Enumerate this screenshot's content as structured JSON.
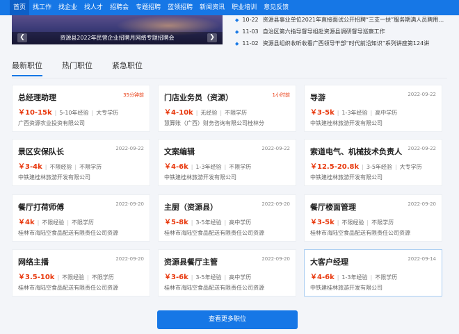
{
  "nav": {
    "items": [
      "首页",
      "找工作",
      "找企业",
      "找人才",
      "招聘会",
      "专题招聘",
      "蓝领招聘",
      "新闻资讯",
      "职业培训",
      "意见反馈"
    ]
  },
  "banner": {
    "caption": "资源县2022年民营企业招聘月网络专题招聘会"
  },
  "news": [
    {
      "date": "10-22",
      "title": "资源县事业单位2021年直接面试公开招聘“三支一扶”服务期满人员聘用…"
    },
    {
      "date": "11-03",
      "title": "自治区第六指导督导组赴资源县调研督导巡察工作"
    },
    {
      "date": "11-02",
      "title": "资源县组织收听收看广西领导干部“时代前沿知识”系列讲座第124讲"
    }
  ],
  "tabs": [
    "最新职位",
    "热门职位",
    "紧急职位"
  ],
  "jobs": [
    {
      "title": "总经理助理",
      "time": "35分钟前",
      "salary": "￥10-15k",
      "exp": "5-10年经验",
      "edu": "大专学历",
      "company": "广西资源农业投资有限公司"
    },
    {
      "title": "门店业务员（资源）",
      "time": "1小时前",
      "salary": "￥4-10k",
      "exp": "无经验",
      "edu": "不限学历",
      "company": "慧算账（广西）财务咨询有限公司桂林分"
    },
    {
      "title": "导游",
      "time": "2022-09-22",
      "salary": "￥3-5k",
      "exp": "1-3年经验",
      "edu": "高中学历",
      "company": "中铁建桂林旅游开发有限公司"
    },
    {
      "title": "景区安保队长",
      "time": "2022-09-22",
      "salary": "￥3-4k",
      "exp": "不限经验",
      "edu": "不限学历",
      "company": "中铁建桂林旅游开发有限公司"
    },
    {
      "title": "文案编辑",
      "time": "2022-09-22",
      "salary": "￥4-6k",
      "exp": "1-3年经验",
      "edu": "不限学历",
      "company": "中铁建桂林旅游开发有限公司"
    },
    {
      "title": "索道电气、机械技术负责人",
      "time": "2022-09-22",
      "salary": "￥12.5-20.8k",
      "exp": "3-5年经验",
      "edu": "大专学历",
      "company": "中铁建桂林旅游开发有限公司"
    },
    {
      "title": "餐厅打荷师傅",
      "time": "2022-09-20",
      "salary": "￥4k",
      "exp": "不限经验",
      "edu": "不限学历",
      "company": "桂林市海陆空食品配送有限责任公司资源"
    },
    {
      "title": "主厨（资源县）",
      "time": "2022-09-20",
      "salary": "￥5-8k",
      "exp": "3-5年经验",
      "edu": "高中学历",
      "company": "桂林市海陆空食品配送有限责任公司资源"
    },
    {
      "title": "餐厅楼面管理",
      "time": "2022-09-20",
      "salary": "￥3-5k",
      "exp": "不限经验",
      "edu": "不限学历",
      "company": "桂林市海陆空食品配送有限责任公司资源"
    },
    {
      "title": "网络主播",
      "time": "2022-09-20",
      "salary": "￥3.5-10k",
      "exp": "不限经验",
      "edu": "不限学历",
      "company": "桂林市海陆空食品配送有限责任公司资源"
    },
    {
      "title": "资源县餐厅主管",
      "time": "2022-09-20",
      "salary": "￥3-6k",
      "exp": "3-5年经验",
      "edu": "高中学历",
      "company": "桂林市海陆空食品配送有限责任公司资源"
    },
    {
      "title": "大客户经理",
      "time": "2022-09-14",
      "salary": "￥4-6k",
      "exp": "1-3年经验",
      "edu": "不限学历",
      "company": "中铁建桂林旅游开发有限公司"
    }
  ],
  "more_button": "查看更多职位",
  "colors": {
    "primary": "#1677e6",
    "salary": "#e8380d"
  }
}
